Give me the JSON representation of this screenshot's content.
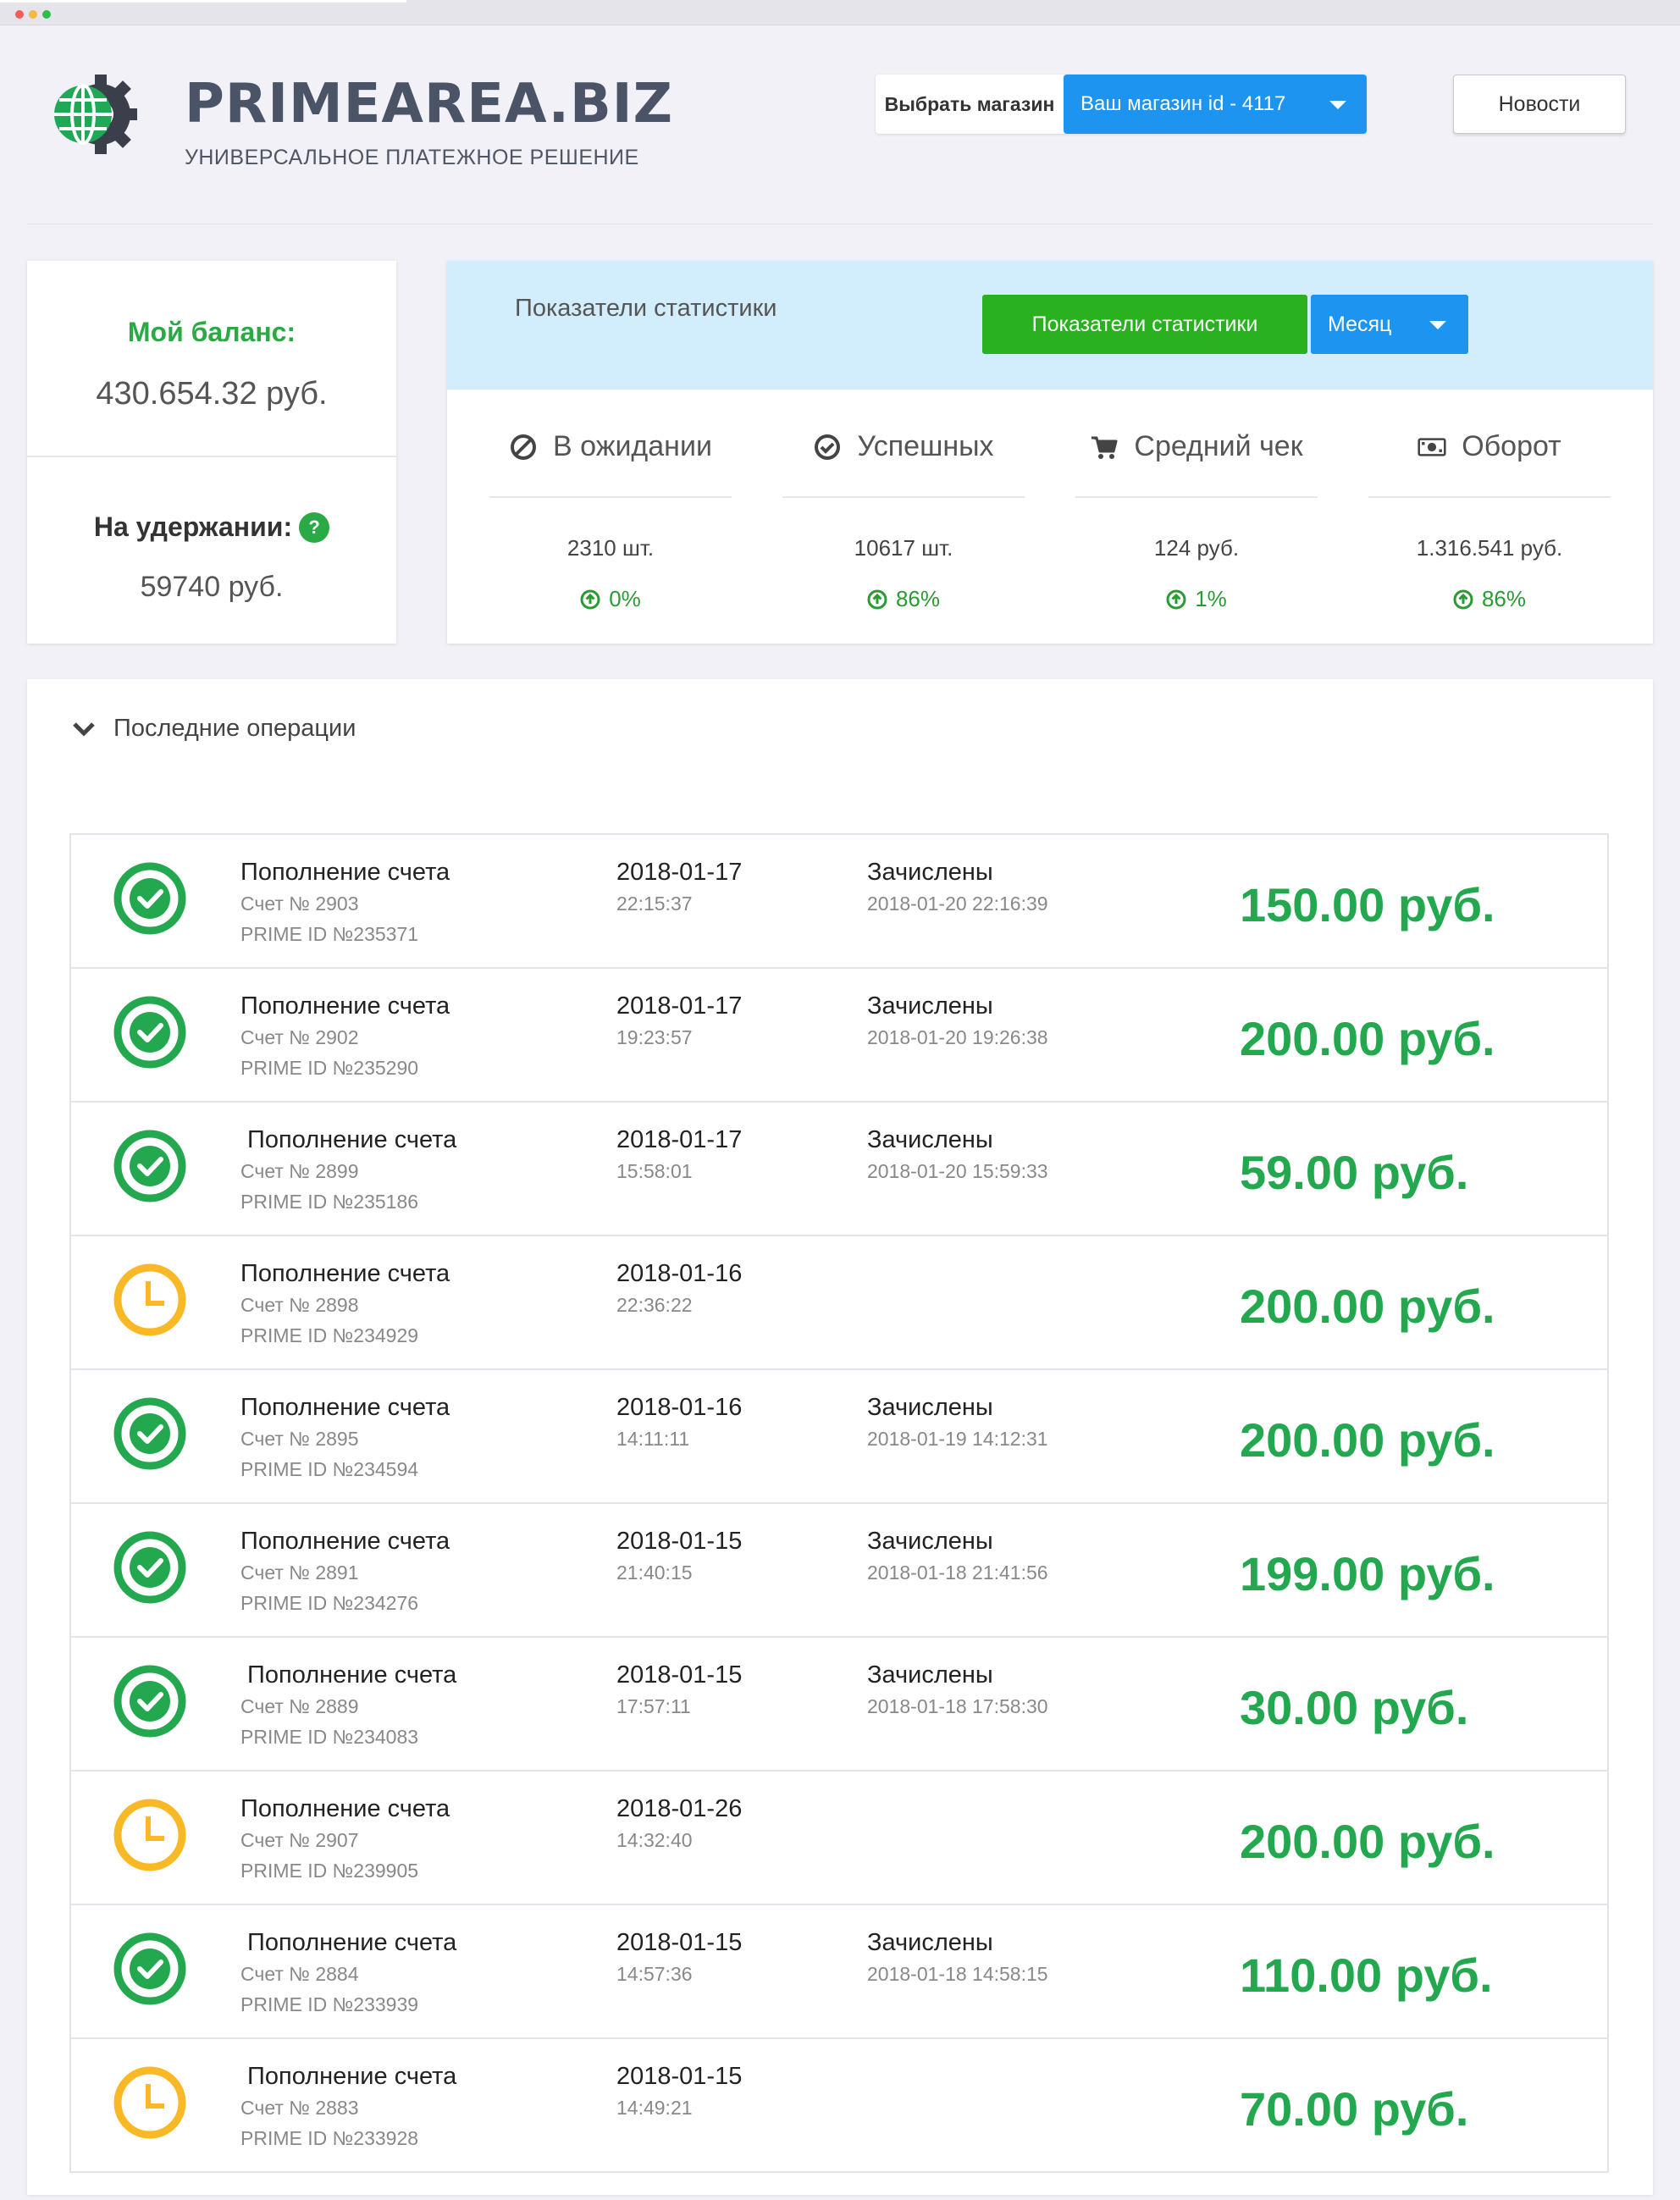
{
  "colors": {
    "accent_blue": "#1c94f0",
    "accent_green": "#2ab11f",
    "success_green": "#24a84f",
    "pending_yellow": "#f9b825",
    "brand_text": "#4b5366"
  },
  "header": {
    "brand": "PRIMEAREA.BIZ",
    "tagline": "УНИВЕРСАЛЬНОЕ ПЛАТЕЖНОЕ РЕШЕНИЕ",
    "shop_label": "Выбрать магазин",
    "shop_value": "Ваш магазин id - 4117",
    "news_label": "Новости"
  },
  "balance": {
    "title": "Мой баланс:",
    "value": "430.654.32 руб.",
    "hold_title": "На удержании:",
    "hold_help": "?",
    "hold_value": "59740 руб."
  },
  "stats": {
    "title": "Показатели статистики",
    "button_label": "Показатели статистики",
    "period": "Месяц",
    "items": [
      {
        "label": "В ожидании",
        "icon": "ban-icon",
        "value": "2310 шт.",
        "change": "0%"
      },
      {
        "label": "Успешных",
        "icon": "check-circle-icon",
        "value": "10617 шт.",
        "change": "86%"
      },
      {
        "label": "Средний чек",
        "icon": "cart-icon",
        "value": "124 руб.",
        "change": "1%"
      },
      {
        "label": "Оборот",
        "icon": "money-icon",
        "value": "1.316.541 руб.",
        "change": "86%"
      }
    ]
  },
  "operations": {
    "title": "Последние операции",
    "rows": [
      {
        "status": "success",
        "title": "Пополнение счета",
        "invoice": "Счет № 2903",
        "prime_id": "PRIME ID №235371",
        "date": "2018-01-17",
        "time": "22:15:37",
        "state": "Зачислены",
        "state_time": "2018-01-20 22:16:39",
        "amount": "150.00 руб."
      },
      {
        "status": "success",
        "title": "Пополнение счета",
        "invoice": "Счет № 2902",
        "prime_id": "PRIME ID №235290",
        "date": "2018-01-17",
        "time": "19:23:57",
        "state": "Зачислены",
        "state_time": "2018-01-20 19:26:38",
        "amount": "200.00 руб."
      },
      {
        "status": "success",
        "title": " Пополнение счета",
        "invoice": "Счет № 2899",
        "prime_id": "PRIME ID №235186",
        "date": "2018-01-17",
        "time": "15:58:01",
        "state": "Зачислены",
        "state_time": "2018-01-20 15:59:33",
        "amount": "59.00 руб."
      },
      {
        "status": "pending",
        "title": "Пополнение счета",
        "invoice": "Счет № 2898",
        "prime_id": "PRIME ID №234929",
        "date": "2018-01-16",
        "time": "22:36:22",
        "state": "",
        "state_time": "",
        "amount": "200.00 руб."
      },
      {
        "status": "success",
        "title": "Пополнение счета",
        "invoice": "Счет № 2895",
        "prime_id": "PRIME ID №234594",
        "date": "2018-01-16",
        "time": "14:11:11",
        "state": "Зачислены",
        "state_time": "2018-01-19 14:12:31",
        "amount": "200.00 руб."
      },
      {
        "status": "success",
        "title": "Пополнение счета",
        "invoice": "Счет № 2891",
        "prime_id": "PRIME ID №234276",
        "date": "2018-01-15",
        "time": "21:40:15",
        "state": "Зачислены",
        "state_time": "2018-01-18 21:41:56",
        "amount": "199.00 руб."
      },
      {
        "status": "success",
        "title": " Пополнение счета",
        "invoice": "Счет № 2889",
        "prime_id": "PRIME ID №234083",
        "date": "2018-01-15",
        "time": "17:57:11",
        "state": "Зачислены",
        "state_time": "2018-01-18 17:58:30",
        "amount": "30.00 руб."
      },
      {
        "status": "pending",
        "title": "Пополнение счета",
        "invoice": "Счет № 2907",
        "prime_id": "PRIME ID №239905",
        "date": "2018-01-26",
        "time": "14:32:40",
        "state": "",
        "state_time": "",
        "amount": "200.00 руб."
      },
      {
        "status": "success",
        "title": " Пополнение счета",
        "invoice": "Счет № 2884",
        "prime_id": "PRIME ID №233939",
        "date": "2018-01-15",
        "time": "14:57:36",
        "state": "Зачислены",
        "state_time": "2018-01-18 14:58:15",
        "amount": "110.00 руб."
      },
      {
        "status": "pending",
        "title": " Пополнение счета",
        "invoice": "Счет № 2883",
        "prime_id": "PRIME ID №233928",
        "date": "2018-01-15",
        "time": "14:49:21",
        "state": "",
        "state_time": "",
        "amount": "70.00 руб."
      }
    ]
  }
}
